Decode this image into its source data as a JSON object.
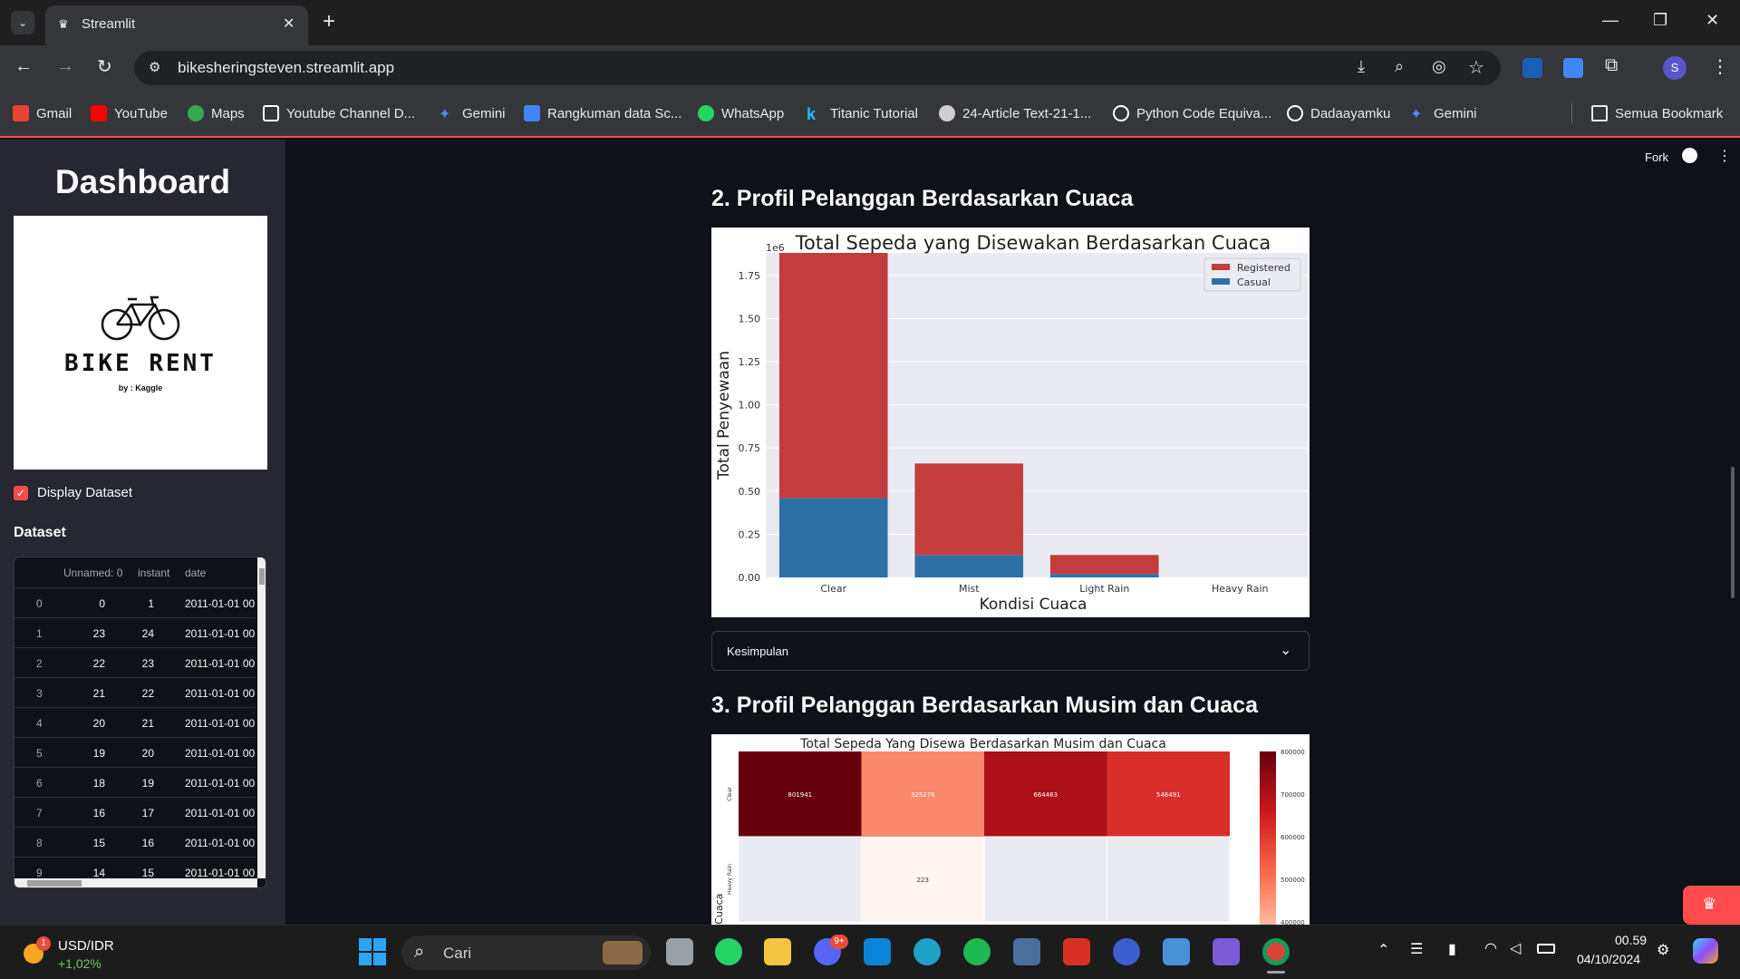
{
  "browser": {
    "tab_title": "Streamlit",
    "url": "bikesheringsteven.streamlit.app",
    "bookmarks": [
      {
        "label": "Gmail",
        "icon": "gmail-icon",
        "color": "#ea4335"
      },
      {
        "label": "YouTube",
        "icon": "youtube-icon",
        "color": "#ff0000"
      },
      {
        "label": "Maps",
        "icon": "maps-icon",
        "color": "#34a853"
      },
      {
        "label": "Youtube Channel D...",
        "icon": "notion-icon",
        "color": "#ffffff"
      },
      {
        "label": "Gemini",
        "icon": "gemini-icon",
        "color": "#4c8df6"
      },
      {
        "label": "Rangkuman data Sc...",
        "icon": "docs-icon",
        "color": "#4285f4"
      },
      {
        "label": "WhatsApp",
        "icon": "whatsapp-icon",
        "color": "#25d366"
      },
      {
        "label": "Titanic Tutorial",
        "icon": "kaggle-icon",
        "color": "#20beff"
      },
      {
        "label": "24-Article Text-21-1...",
        "icon": "globe-icon",
        "color": "#cfcfcf"
      },
      {
        "label": "Python Code Equiva...",
        "icon": "chatgpt-icon",
        "color": "#ffffff"
      },
      {
        "label": "Dadaayamku",
        "icon": "chatgpt-icon",
        "color": "#ffffff"
      },
      {
        "label": "Gemini",
        "icon": "gemini-icon",
        "color": "#4c8df6"
      }
    ],
    "all_bookmarks": "Semua Bookmark",
    "profile_initial": "S"
  },
  "sidebar": {
    "title": "Dashboard",
    "logo_text": "BIKE RENT",
    "logo_sub": "by : Kaggle",
    "checkbox_label": "Display Dataset",
    "dataset_label": "Dataset",
    "table": {
      "headers": [
        "",
        "Unnamed: 0",
        "instant",
        "date"
      ],
      "rows": [
        [
          "0",
          "0",
          "1",
          "2011-01-01 00"
        ],
        [
          "1",
          "23",
          "24",
          "2011-01-01 00"
        ],
        [
          "2",
          "22",
          "23",
          "2011-01-01 00"
        ],
        [
          "3",
          "21",
          "22",
          "2011-01-01 00"
        ],
        [
          "4",
          "20",
          "21",
          "2011-01-01 00"
        ],
        [
          "5",
          "19",
          "20",
          "2011-01-01 00"
        ],
        [
          "6",
          "18",
          "19",
          "2011-01-01 00"
        ],
        [
          "7",
          "16",
          "17",
          "2011-01-01 00"
        ],
        [
          "8",
          "15",
          "16",
          "2011-01-01 00"
        ],
        [
          "9",
          "14",
          "15",
          "2011-01-01 00"
        ]
      ]
    }
  },
  "main": {
    "fork_label": "Fork",
    "section2_title": "2. Profil Pelanggan Berdasarkan Cuaca",
    "expander_label": "Kesimpulan",
    "section3_title": "3. Profil Pelanggan Berdasarkan Musim dan Cuaca"
  },
  "chart_data": [
    {
      "type": "bar",
      "title": "Total Sepeda yang Disewakan Berdasarkan Cuaca",
      "xlabel": "Kondisi Cuaca",
      "ylabel": "Total Penyewaan",
      "scale_label": "1e6",
      "categories": [
        "Clear",
        "Mist",
        "Light Rain",
        "Heavy Rain"
      ],
      "stacked": true,
      "series": [
        {
          "name": "Casual",
          "color": "#2e6fa6",
          "values": [
            0.46,
            0.13,
            0.02,
            0.0
          ]
        },
        {
          "name": "Registered",
          "color": "#c33c3e",
          "values": [
            1.42,
            0.53,
            0.11,
            0.0
          ]
        }
      ],
      "yticks": [
        "0.00",
        "0.25",
        "0.50",
        "0.75",
        "1.00",
        "1.25",
        "1.50",
        "1.75"
      ],
      "ylim": [
        0,
        1.88
      ],
      "legend": "top-right",
      "grid": true
    },
    {
      "type": "heatmap",
      "title": "Total Sepeda Yang Disewa Berdasarkan Musim dan Cuaca",
      "ylabel_partial": "i Cuaca",
      "row_labels": [
        "Clear",
        "Heavy Rain"
      ],
      "cells": [
        [
          801941,
          325278,
          664463,
          546491
        ],
        [
          null,
          223,
          null,
          null
        ]
      ],
      "colorbar_ticks": [
        "800000",
        "700000",
        "600000",
        "500000",
        "400000"
      ]
    }
  ],
  "taskbar": {
    "widget_title": "USD/IDR",
    "widget_change": "+1,02%",
    "widget_badge": "1",
    "search_placeholder": "Cari",
    "time": "00.59",
    "date": "04/10/2024",
    "discord_badge": "9+"
  }
}
